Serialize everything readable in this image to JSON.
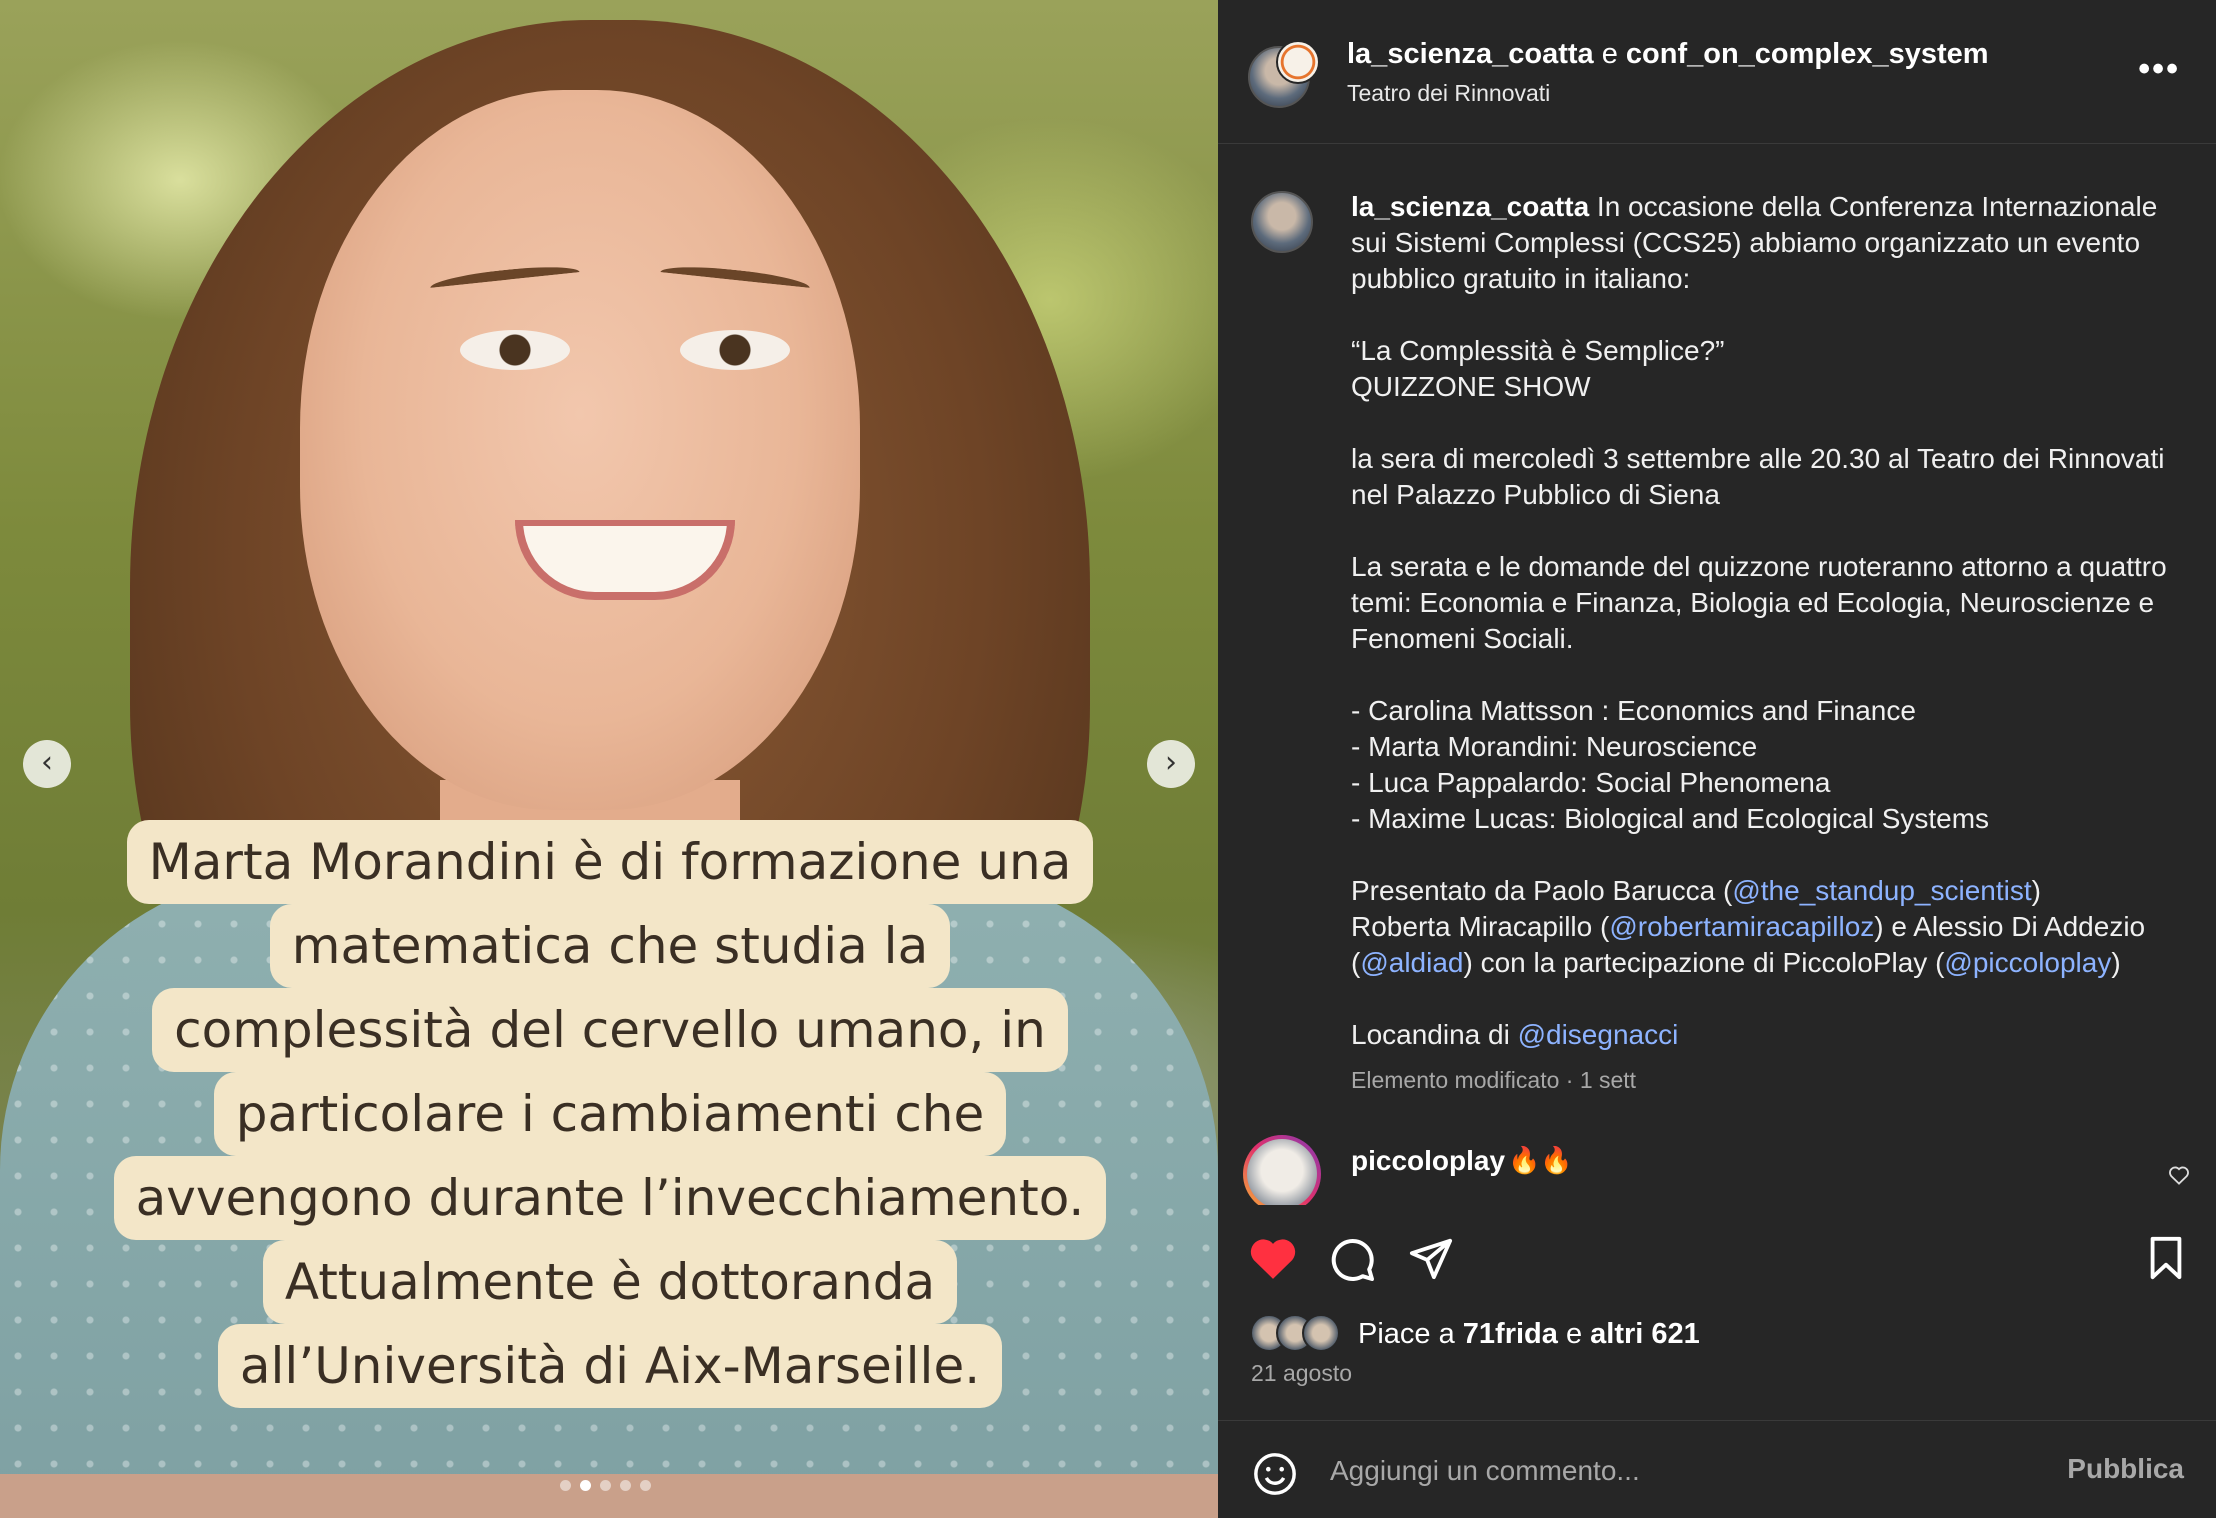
{
  "media": {
    "caption_lines": [
      "Marta Morandini è di formazione una",
      "matematica che studia la",
      "complessità del cervello umano, in",
      "particolare i cambiamenti che",
      "avvengono durante l’invecchiamento.",
      "Attualmente è dottoranda",
      "all’Università di Aix-Marseille."
    ],
    "prev_icon": "chevron-left-icon",
    "next_icon": "chevron-right-icon",
    "carousel_total": 5,
    "carousel_active": 2
  },
  "header": {
    "author": "la_scienza_coatta",
    "connector": " e ",
    "coauthor": "conf_on_complex_system",
    "location": "Teatro dei Rinnovati",
    "more_icon": "more-options-icon"
  },
  "caption": {
    "username": "la_scienza_coatta",
    "intro": "In occasione della Conferenza Internazionale sui Sistemi Complessi (CCS25) abbiamo organizzato un evento pubblico gratuito in italiano:",
    "title_line": "“La Complessità è Semplice?”",
    "subtitle_line": "QUIZZONE SHOW",
    "when_where": "la sera di mercoledì 3 settembre alle 20.30 al Teatro dei Rinnovati nel Palazzo Pubblico di Siena",
    "topics": "La serata e le domande del quizzone ruoteranno attorno a quattro temi: Economia e Finanza, Biologia ed Ecologia, Neuroscienze e Fenomeni Sociali.",
    "speakers": [
      "- Carolina Mattsson : Economics and Finance",
      "- Marta Morandini: Neuroscience",
      "- Luca Pappalardo: Social Phenomena",
      "- Maxime Lucas: Biological and Ecological Systems"
    ],
    "presented_prefix": "Presentato da Paolo Barucca (",
    "mention_1": "@the_standup_scientist",
    "presented_mid1": ")",
    "presented_line2_prefix": "Roberta Miracapillo (",
    "mention_2": "@robertamiracapilloz",
    "presented_mid2": ") e Alessio Di Addezio",
    "presented_line3_prefix": "(",
    "mention_3": "@aldiad",
    "presented_mid3": ") con la partecipazione di PiccoloPlay (",
    "mention_4": "@piccoloplay",
    "presented_end": ")",
    "poster_prefix": "Locandina di ",
    "mention_5": "@disegnacci",
    "meta": "Elemento modificato · 1 sett"
  },
  "comment": {
    "username": "piccoloplay",
    "text": "🔥🔥",
    "like_icon": "heart-outline-icon"
  },
  "actions": {
    "like_icon": "heart-filled-icon",
    "comment_icon": "comment-icon",
    "share_icon": "send-icon",
    "save_icon": "bookmark-icon",
    "likes_prefix": "Piace a ",
    "likes_user": "71frida",
    "likes_mid": " e ",
    "likes_rest": "altri 621",
    "date": "21 agosto",
    "like_color": "#ff3040"
  },
  "comment_bar": {
    "emoji_icon": "emoji-icon",
    "placeholder": "Aggiungi un commento...",
    "publish_label": "Pubblica"
  }
}
